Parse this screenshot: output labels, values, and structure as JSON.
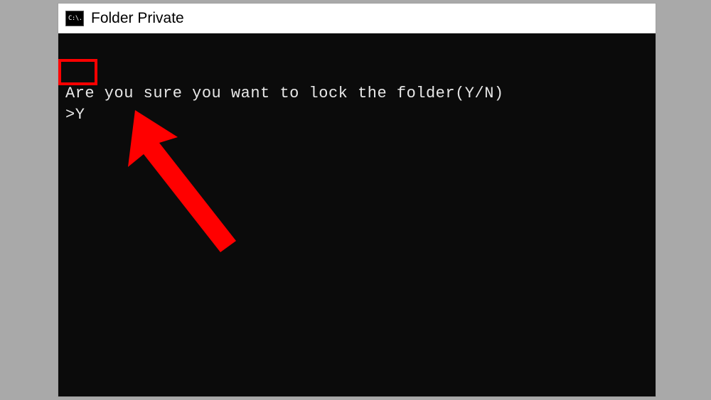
{
  "window": {
    "title": "Folder Private",
    "icon_label": "C:\\."
  },
  "terminal": {
    "line1": "Are you sure you want to lock the folder(Y/N)",
    "prompt": ">",
    "input_value": "Y"
  },
  "annotations": {
    "highlight_color": "#ff0000",
    "arrow_color": "#ff0000"
  }
}
